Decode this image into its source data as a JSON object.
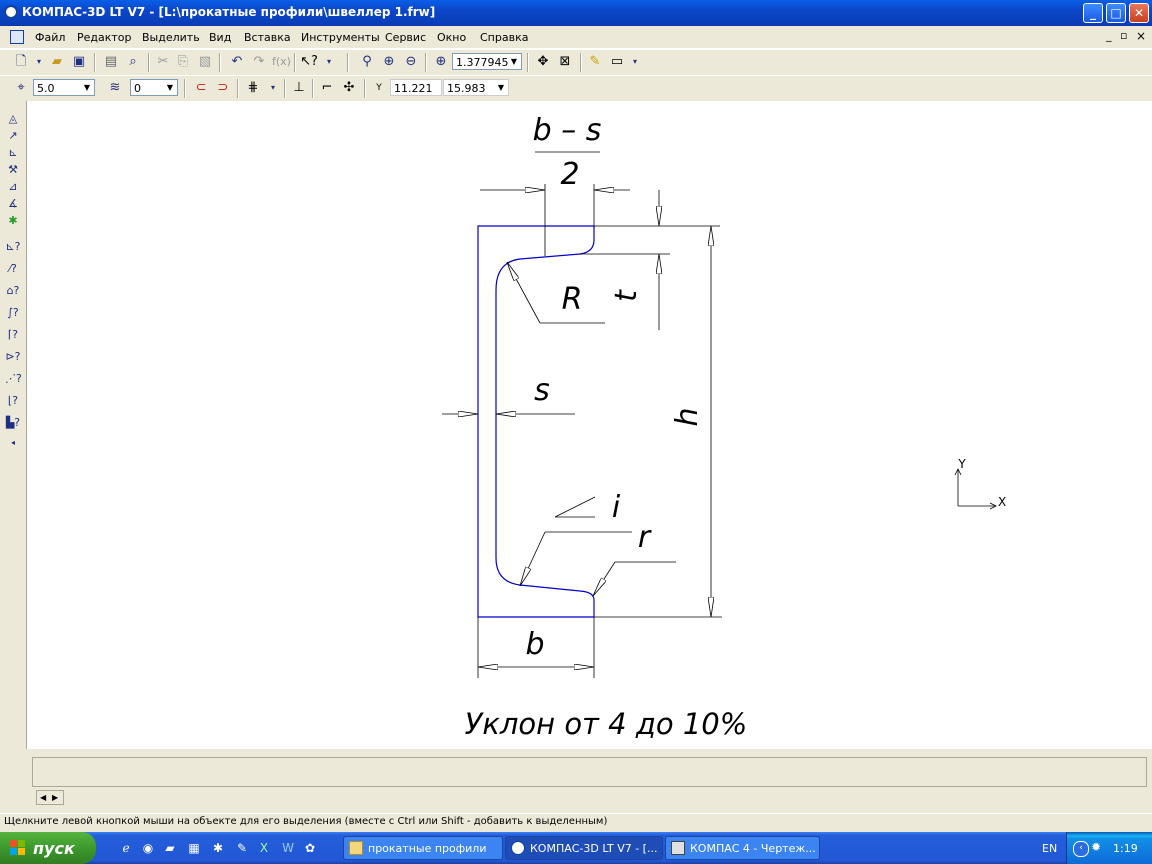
{
  "window": {
    "title": "КОМПАС-3D LT V7 - [L:\\прокатные профили\\швеллер 1.frw]",
    "controls": {
      "minimize": "_",
      "maximize": "□",
      "close": "✕"
    }
  },
  "menu": {
    "items": [
      "Файл",
      "Редактор",
      "Выделить",
      "Вид",
      "Вставка",
      "Инструменты",
      "Сервис",
      "Окно",
      "Справка"
    ],
    "doc_controls": [
      "_",
      "▫",
      "×"
    ]
  },
  "toolbar1": {
    "zoom_value": "1.377945"
  },
  "toolbar2": {
    "line_width": "5.0",
    "layer": "0",
    "coord_label": "Y",
    "coord_x": "11.221",
    "coord_y": "15.983"
  },
  "drawing": {
    "dim_b_s_top": "b – s",
    "dim_b_s_bottom": "2",
    "label_R": "R",
    "label_t": "t",
    "label_s": "s",
    "label_h": "h",
    "label_i": "i",
    "label_r": "r",
    "label_b": "b",
    "caption": "Уклон от 4 до 10%",
    "axis_x": "X",
    "axis_y": "Y",
    "colors": {
      "profile": "#0000cc",
      "dims": "#000000"
    }
  },
  "status": {
    "hint": "Щелкните левой кнопкой мыши на объекте для его выделения (вместе с Ctrl или Shift - добавить к выделенным)"
  },
  "taskbar": {
    "start": "пуск",
    "tasks": [
      "прокатные профили",
      "КОМПАС-3D LT V7 - [...",
      "КОМПАС 4 - Чертеж..."
    ],
    "lang": "EN",
    "clock": "1:19"
  }
}
